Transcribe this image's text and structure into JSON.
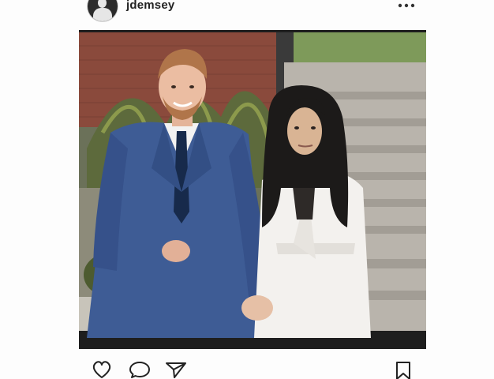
{
  "header": {
    "username": "jdemsey",
    "avatar_icon": "profile-silhouette-icon",
    "more_icon": "more-options-icon"
  },
  "post": {
    "image_icon": "post-photo"
  },
  "actions": {
    "like_icon": "heart-icon",
    "comment_icon": "comment-icon",
    "share_icon": "send-icon",
    "save_icon": "bookmark-icon"
  },
  "colors": {
    "background": "#fdfdfd",
    "text": "#222222",
    "photo_frame": "#1e1e1e"
  }
}
